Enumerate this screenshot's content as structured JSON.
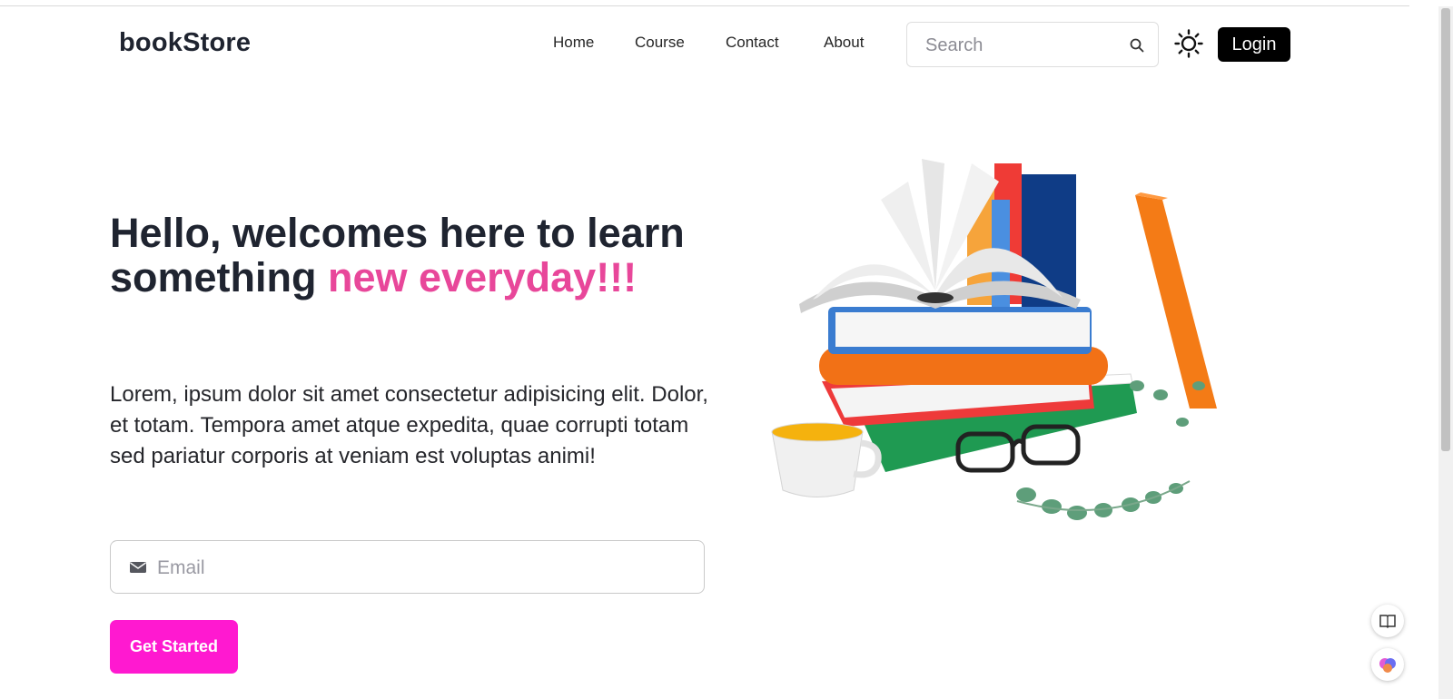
{
  "brand": "bookStore",
  "nav": [
    {
      "label": "Home"
    },
    {
      "label": "Course"
    },
    {
      "label": "Contact"
    },
    {
      "label": "About"
    }
  ],
  "search": {
    "placeholder": "Search",
    "icon": "search-icon"
  },
  "theme_toggle_icon": "sun-icon",
  "login_label": "Login",
  "hero": {
    "title_part1": "Hello, welcomes here to learn something ",
    "title_accent": "new everyday!!!",
    "accent_color": "#e8479a",
    "text": "Lorem, ipsum dolor sit amet consectetur adipisicing elit. Dolor, et totam. Tempora amet atque expedita, quae corrupti totam sed pariatur corporis at veniam est voluptas animi!",
    "email_placeholder": "Email",
    "email_icon": "envelope-icon",
    "cta_label": "Get Started",
    "cta_color": "#ff19d0"
  },
  "floating_buttons": [
    {
      "icon": "reader-icon"
    },
    {
      "icon": "brain-icon"
    }
  ]
}
